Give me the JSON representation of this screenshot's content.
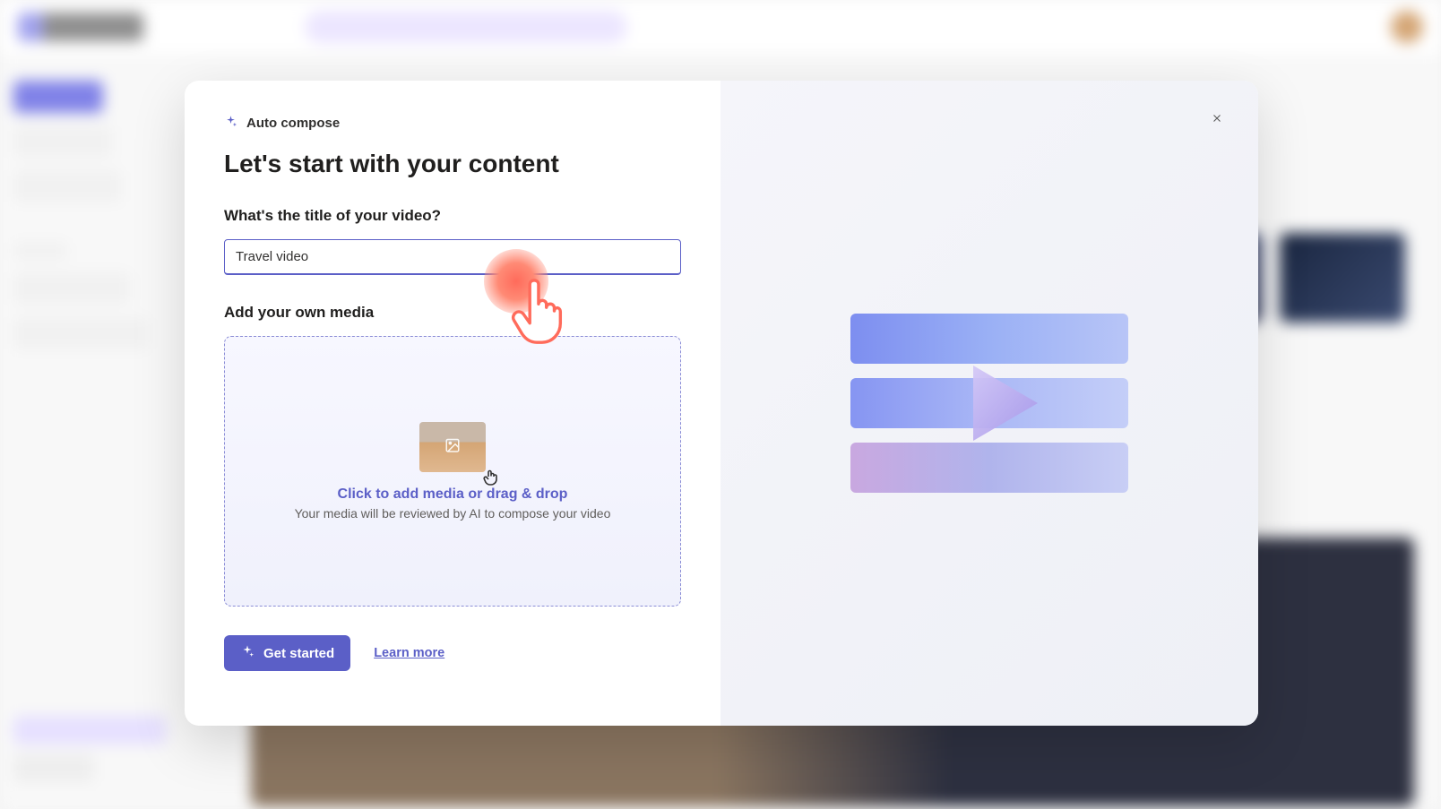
{
  "modal": {
    "feature_name": "Auto compose",
    "title": "Let's start with your content",
    "title_question": "What's the title of your video?",
    "title_input_value": "Travel video",
    "media_section_label": "Add your own media",
    "drop_primary": "Click to add media or drag & drop",
    "drop_secondary": "Your media will be reviewed by AI to compose your video",
    "get_started_label": "Get started",
    "learn_more_label": "Learn more"
  }
}
